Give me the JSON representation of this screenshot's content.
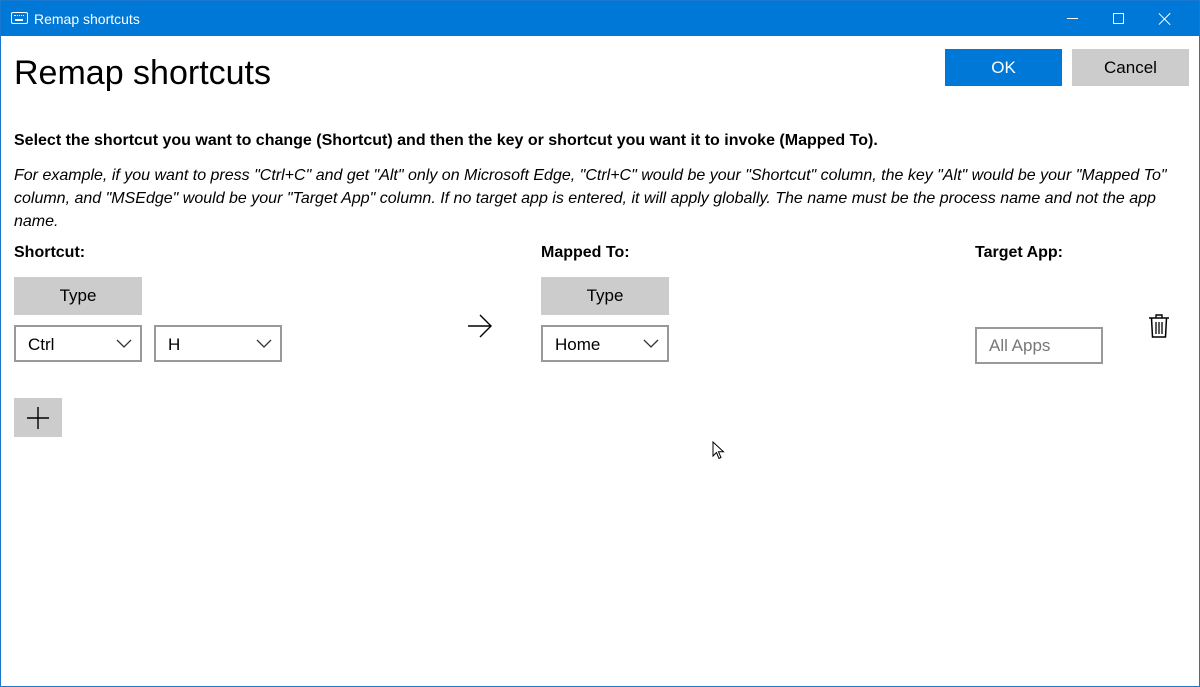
{
  "window": {
    "title": "Remap shortcuts",
    "accent_color": "#0078d7",
    "icons": {
      "app": "keyboard-icon",
      "minimize": "minimize-icon",
      "maximize": "maximize-icon",
      "close": "close-icon"
    }
  },
  "header": {
    "heading": "Remap shortcuts",
    "ok_label": "OK",
    "cancel_label": "Cancel"
  },
  "instructions": {
    "main": "Select the shortcut you want to change (Shortcut) and then the key or shortcut you want it to invoke (Mapped To).",
    "example": "For example, if you want to press \"Ctrl+C\" and get \"Alt\" only on Microsoft Edge, \"Ctrl+C\" would be your \"Shortcut\" column, the key \"Alt\" would be your \"Mapped To\" column, and \"MSEdge\" would be your \"Target App\" column. If no target app is entered, it will apply globally. The name must be the process name and not the app name."
  },
  "columns": {
    "shortcut": "Shortcut:",
    "mapped_to": "Mapped To:",
    "target_app": "Target App:"
  },
  "row": {
    "shortcut_type_label": "Type",
    "shortcut_keys": [
      "Ctrl",
      "H"
    ],
    "arrow_icon": "arrow-right-icon",
    "mapped_type_label": "Type",
    "mapped_key": "Home",
    "target_placeholder": "All Apps",
    "target_value": "",
    "delete_icon": "trash-icon"
  },
  "add_button_icon": "plus-icon"
}
